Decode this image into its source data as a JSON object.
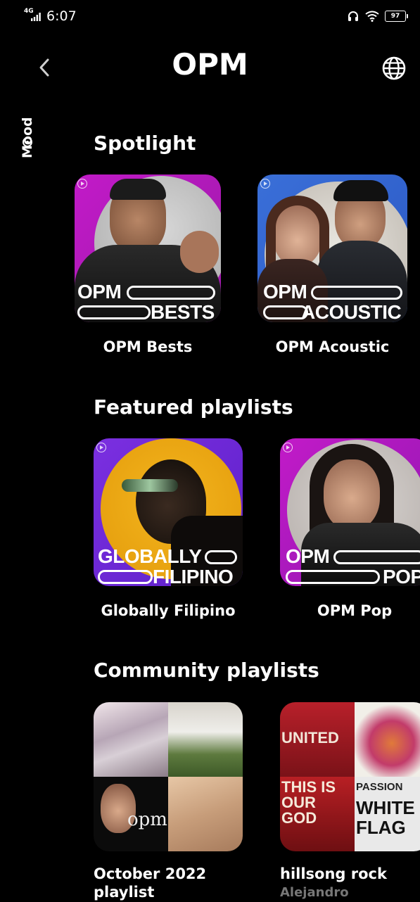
{
  "status_bar": {
    "network": "4G",
    "time": "6:07",
    "battery": "97"
  },
  "header": {
    "title": "OPM",
    "back_icon": "chevron-left-icon",
    "globe_icon": "globe-icon"
  },
  "side_tab": {
    "label": "Mood",
    "icon": "mood-target-icon"
  },
  "sections": {
    "spotlight": {
      "title": "Spotlight",
      "cards": [
        {
          "title": "OPM Bests",
          "cover_line1": "OPM",
          "cover_line2": "BESTS"
        },
        {
          "title": "OPM Acoustic",
          "cover_line1": "OPM",
          "cover_line2": "ACOUSTIC"
        }
      ]
    },
    "featured": {
      "title": "Featured playlists",
      "cards": [
        {
          "title": "Globally Filipino",
          "cover_line1": "GLOBALLY",
          "cover_line2": "FILIPINO"
        },
        {
          "title": "OPM Pop",
          "cover_line1": "OPM",
          "cover_line2": "POP"
        }
      ]
    },
    "community": {
      "title": "Community playlists",
      "cards": [
        {
          "title": "October 2022 playlist",
          "cover_text": "opm"
        },
        {
          "title": "hillsong rock",
          "subtitle": "Alejandro",
          "cover_texts": [
            "UNITED",
            "THIS IS OUR GOD",
            "PASSION",
            "WHITE FLAG"
          ]
        }
      ]
    }
  },
  "colors": {
    "background": "#000000",
    "accent_purple": "#7b2fe0",
    "magenta": "#c21ac8",
    "blue": "#3a6fd8"
  }
}
